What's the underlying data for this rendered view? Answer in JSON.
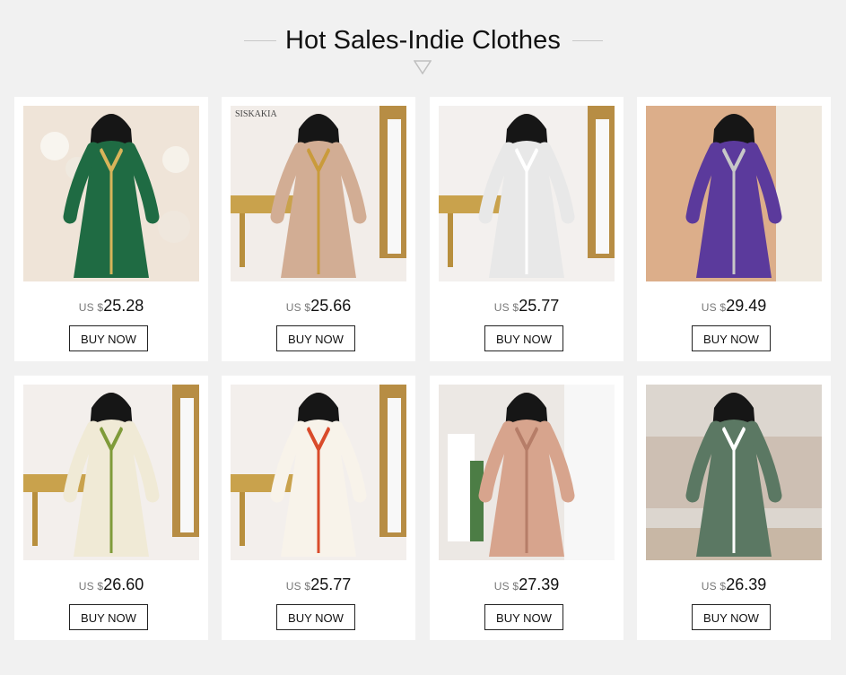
{
  "section": {
    "title": "Hot Sales-Indie Clothes"
  },
  "products": [
    {
      "currency": "US $",
      "price": "25.28",
      "button_label": "BUY NOW",
      "image": "green-satin-abaya-photo",
      "dress_color": "#1f6b43",
      "trim_color": "#d8b45a",
      "bg_color": "#efe4d8"
    },
    {
      "currency": "US $",
      "price": "25.66",
      "button_label": "BUY NOW",
      "image": "beige-abaya-photo",
      "dress_color": "#d2ad94",
      "trim_color": "#c99b3b",
      "bg_color": "#f2ede9",
      "watermark": "SISKAKIA"
    },
    {
      "currency": "US $",
      "price": "25.77",
      "button_label": "BUY NOW",
      "image": "black-white-leaf-print-abaya-photo",
      "dress_color": "#e8e8e8",
      "trim_color": "#ffffff",
      "bg_color": "#f3f0ee"
    },
    {
      "currency": "US $",
      "price": "29.49",
      "button_label": "BUY NOW",
      "image": "purple-satin-abaya-photo",
      "dress_color": "#5b3a9c",
      "trim_color": "#c8c8c8",
      "bg_color": "#e6c4a8"
    },
    {
      "currency": "US $",
      "price": "26.60",
      "button_label": "BUY NOW",
      "image": "cream-leaf-print-abaya-photo",
      "dress_color": "#f0ead6",
      "trim_color": "#7f9b3a",
      "bg_color": "#f3efec"
    },
    {
      "currency": "US $",
      "price": "25.77",
      "button_label": "BUY NOW",
      "image": "floral-white-abaya-photo",
      "dress_color": "#f8f3ea",
      "trim_color": "#d94b2b",
      "bg_color": "#f3efec"
    },
    {
      "currency": "US $",
      "price": "27.39",
      "button_label": "BUY NOW",
      "image": "dusty-pink-dress-photo",
      "dress_color": "#d7a48d",
      "trim_color": "#b67d68",
      "bg_color": "#e9e5e0"
    },
    {
      "currency": "US $",
      "price": "26.39",
      "button_label": "BUY NOW",
      "image": "green-floral-abaya-photo",
      "dress_color": "#5b7863",
      "trim_color": "#ffffff",
      "bg_color": "#d9d3cb"
    }
  ],
  "colors": {
    "page_background": "#f1f1f1",
    "card_background": "#ffffff",
    "button_border": "#222222",
    "price_currency": "#777777"
  }
}
